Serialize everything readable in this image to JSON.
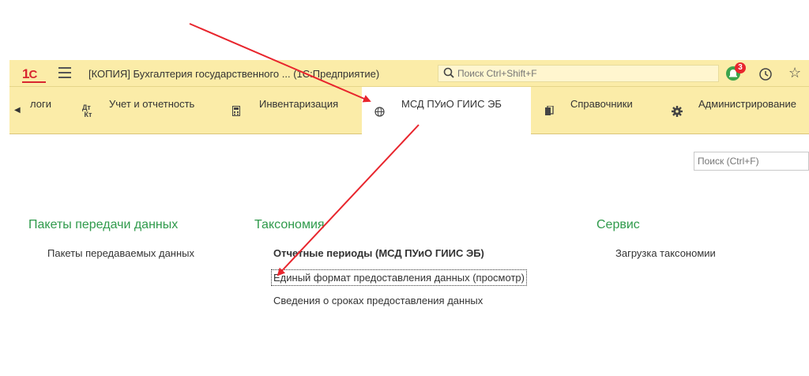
{
  "window": {
    "title": "[КОПИЯ] Бухгалтерия государственного ... (1С:Предприятие)",
    "search_placeholder": "Поиск Ctrl+Shift+F",
    "notification_count": "3"
  },
  "sections": [
    {
      "label": "логи",
      "icon": "tax-icon"
    },
    {
      "label": "Учет и отчетность",
      "icon": "debit-credit-icon"
    },
    {
      "label": "Инвентаризация",
      "icon": "calculator-icon"
    },
    {
      "label": "МСД ПУиО ГИИС ЭБ",
      "icon": "globe-icon",
      "active": true
    },
    {
      "label": "Справочники",
      "icon": "books-icon"
    },
    {
      "label": "Администрирование",
      "icon": "gear-icon"
    }
  ],
  "content": {
    "search_placeholder": "Поиск (Ctrl+F)",
    "groups": [
      {
        "title": "Пакеты передачи данных",
        "items": [
          "Пакеты передаваемых данных"
        ]
      },
      {
        "title": "Таксономия",
        "items": [
          "Отчетные периоды (МСД ПУиО ГИИС ЭБ)",
          "Единый формат предоставления данных (просмотр)",
          "Сведения о сроках предоставления данных"
        ]
      },
      {
        "title": "Сервис",
        "items": [
          "Загрузка таксономии"
        ]
      }
    ]
  },
  "colors": {
    "panel": "#fbeca8",
    "group_title": "#2f9a4b",
    "annotation_arrow": "#e8252d"
  }
}
